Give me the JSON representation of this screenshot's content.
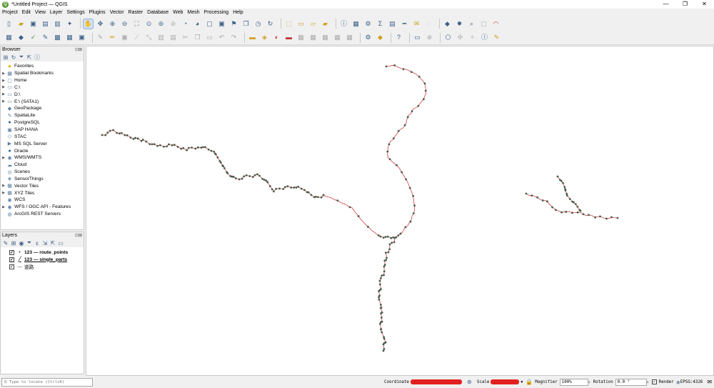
{
  "window": {
    "title": "*Untitled Project — QGIS",
    "app_icon": "Q"
  },
  "menu": [
    "Project",
    "Edit",
    "View",
    "Layer",
    "Settings",
    "Plugins",
    "Vector",
    "Raster",
    "Database",
    "Web",
    "Mesh",
    "Processing",
    "Help"
  ],
  "browser": {
    "title": "Browser",
    "items": [
      {
        "label": "Favorites",
        "icon": "star-icon",
        "glyph": "★",
        "expand": false
      },
      {
        "label": "Spatial Bookmarks",
        "icon": "bookmark-icon",
        "glyph": "▦",
        "expand": true
      },
      {
        "label": "Home",
        "icon": "home-folder-icon",
        "glyph": "▢",
        "expand": true
      },
      {
        "label": "C:\\",
        "icon": "drive-icon",
        "glyph": "▭",
        "expand": true
      },
      {
        "label": "D:\\",
        "icon": "drive-icon",
        "glyph": "▭",
        "expand": true
      },
      {
        "label": "E:\\ (SATA1)",
        "icon": "drive-icon",
        "glyph": "▭",
        "expand": true
      },
      {
        "label": "GeoPackage",
        "icon": "geopackage-icon",
        "glyph": "◆",
        "expand": false
      },
      {
        "label": "SpatiaLite",
        "icon": "spatialite-icon",
        "glyph": "✎",
        "expand": false
      },
      {
        "label": "PostgreSQL",
        "icon": "postgresql-icon",
        "glyph": "●",
        "expand": false
      },
      {
        "label": "SAP HANA",
        "icon": "sap-hana-icon",
        "glyph": "▣",
        "expand": false
      },
      {
        "label": "STAC",
        "icon": "stac-icon",
        "glyph": "◇",
        "expand": false
      },
      {
        "label": "MS SQL Server",
        "icon": "mssql-icon",
        "glyph": "▶",
        "expand": false
      },
      {
        "label": "Oracle",
        "icon": "oracle-icon",
        "glyph": "●",
        "expand": false
      },
      {
        "label": "WMS/WMTS",
        "icon": "wms-icon",
        "glyph": "◉",
        "expand": true
      },
      {
        "label": "Cloud",
        "icon": "cloud-icon",
        "glyph": "☁",
        "expand": false
      },
      {
        "label": "Scenes",
        "icon": "scenes-icon",
        "glyph": "◎",
        "expand": false
      },
      {
        "label": "SensorThings",
        "icon": "sensorthings-icon",
        "glyph": "◈",
        "expand": false
      },
      {
        "label": "Vector Tiles",
        "icon": "vector-tiles-icon",
        "glyph": "▦",
        "expand": true
      },
      {
        "label": "XYZ Tiles",
        "icon": "xyz-tiles-icon",
        "glyph": "▦",
        "expand": true
      },
      {
        "label": "WCS",
        "icon": "wcs-icon",
        "glyph": "◉",
        "expand": false
      },
      {
        "label": "WFS / OGC API - Features",
        "icon": "wfs-icon",
        "glyph": "◉",
        "expand": true
      },
      {
        "label": "ArcGIS REST Servers",
        "icon": "arcgis-icon",
        "glyph": "◍",
        "expand": false
      }
    ]
  },
  "layers": {
    "title": "Layers",
    "items": [
      {
        "label": "123 — route_points",
        "checked": "✓",
        "icon": "point-layer-icon",
        "glyph": "•",
        "style": "bold"
      },
      {
        "label": "123 — single_parts",
        "checked": "✓",
        "icon": "line-layer-icon",
        "glyph": "╱",
        "style": "bold ul"
      },
      {
        "label": "道路",
        "checked": "✓",
        "icon": "line-layer-icon",
        "glyph": "—",
        "style": ""
      }
    ]
  },
  "status": {
    "locate_placeholder": "Q  Type to locate (Ctrl+K)",
    "coordinate_label": "Coordinate",
    "scale_label": "Scale",
    "magnifier_label": "Magnifier",
    "magnifier_value": "100%",
    "rotation_label": "Rotation",
    "rotation_value": "0.0 °",
    "render_label": "Render",
    "render_checked": "✓",
    "crs": "EPSG:4326"
  },
  "colors": {
    "route_line": "#d04040",
    "route_point": "#4a5a4a",
    "accent": "#3a5f8a"
  }
}
